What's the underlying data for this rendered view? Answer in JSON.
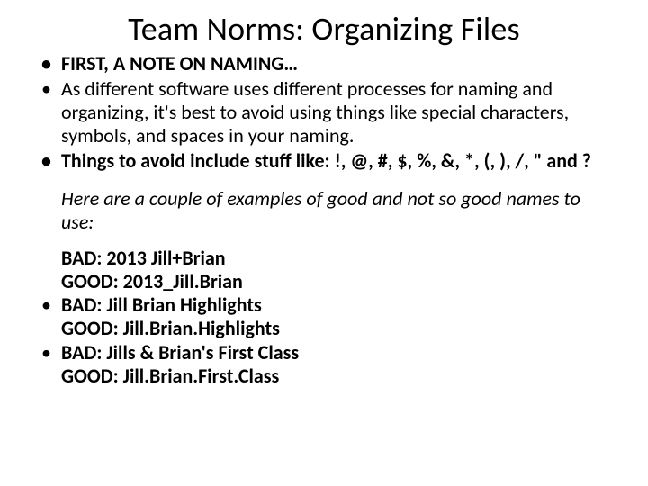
{
  "title": "Team Norms: Organizing Files",
  "b1": "FIRST, A NOTE ON NAMING…",
  "b2": "As different software uses different processes for naming and organizing, it's best to avoid using things like special characters, symbols, and spaces in your naming.",
  "b3": "Things to avoid include stuff like: !, @, #, $, %, &, *, (, ), /, \" and ?",
  "intro": "Here are a couple of examples of good and not so good names to use:",
  "ex1bad": "BAD: 2013 Jill+Brian",
  "ex1good": "GOOD: 2013_Jill.Brian",
  "ex2bad": "BAD: Jill Brian Highlights",
  "ex2good": "GOOD: Jill.Brian.Highlights",
  "ex3bad": "BAD: Jills & Brian's First Class",
  "ex3good": "GOOD: Jill.Brian.First.Class"
}
